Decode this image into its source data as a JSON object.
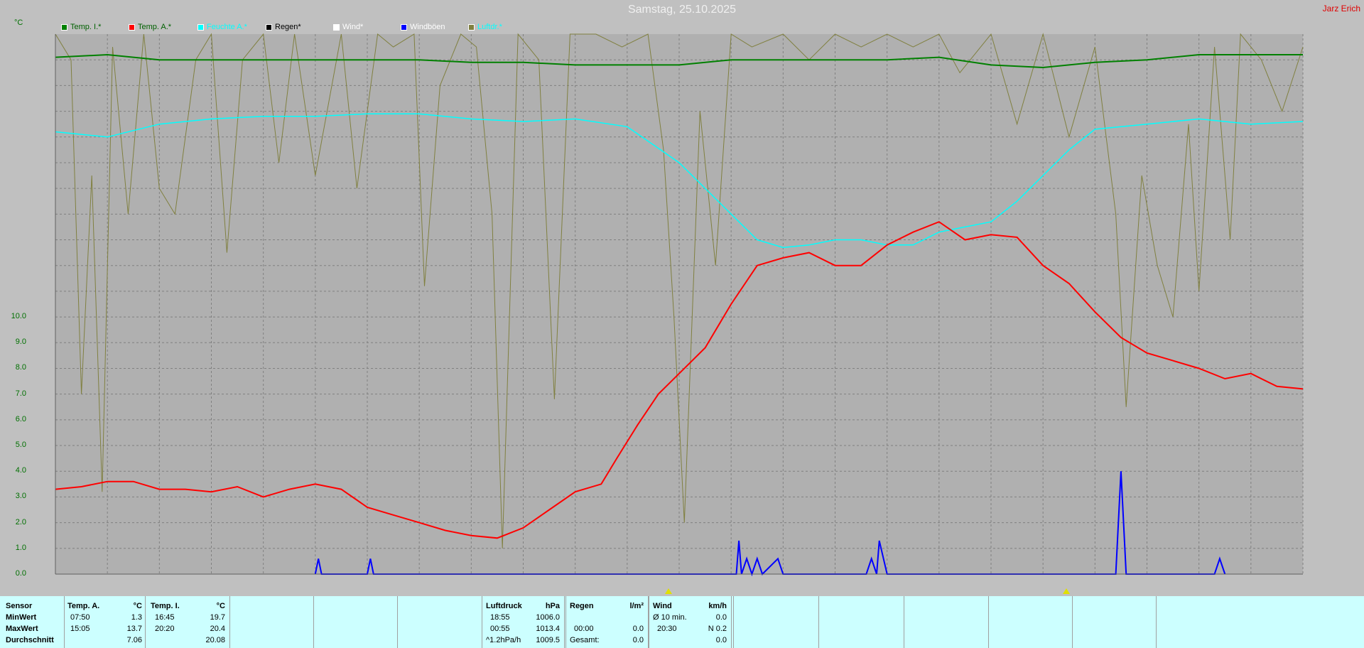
{
  "header": {
    "title": "Samstag, 25.10.2025",
    "station": "Jarz Erich",
    "unit": "°C"
  },
  "legend": [
    {
      "label": "Temp. I.*",
      "color": "#008000",
      "text_color": "#006000"
    },
    {
      "label": "Temp. A.*",
      "color": "#ff0000",
      "text_color": "#006000"
    },
    {
      "label": "Feuchte A.*",
      "color": "#00ffff",
      "text_color": "#00ffff"
    },
    {
      "label": "Regen*",
      "color": "#000000",
      "text_color": "#000000"
    },
    {
      "label": "Wind*",
      "color": "#ffffff",
      "text_color": "#ffffff"
    },
    {
      "label": "Windböen",
      "color": "#0000ff",
      "text_color": "#ffffff"
    },
    {
      "label": "Luftdr.*",
      "color": "#808040",
      "text_color": "#00ffff"
    }
  ],
  "colors": {
    "background": "#c0c0c0",
    "plot": "#b0b0b0",
    "grid": "#808080",
    "axis_text": "#007000"
  },
  "chart_data": {
    "type": "line",
    "title": "Samstag, 25.10.2025",
    "ylabel": "°C",
    "ylim": [
      0,
      21
    ],
    "y_ticks": [
      "0.0",
      "1.0",
      "2.0",
      "3.0",
      "4.0",
      "5.0",
      "6.0",
      "7.0",
      "8.0",
      "9.0",
      "10.0"
    ],
    "x_hours": [
      0,
      24
    ],
    "series": [
      {
        "name": "Temp. A.*",
        "color": "#ff0000",
        "points": [
          [
            0,
            3.3
          ],
          [
            0.5,
            3.4
          ],
          [
            1,
            3.6
          ],
          [
            1.5,
            3.6
          ],
          [
            2,
            3.3
          ],
          [
            2.5,
            3.3
          ],
          [
            3,
            3.2
          ],
          [
            3.5,
            3.4
          ],
          [
            4,
            3.0
          ],
          [
            4.5,
            3.3
          ],
          [
            5,
            3.5
          ],
          [
            5.5,
            3.3
          ],
          [
            6,
            2.6
          ],
          [
            6.5,
            2.3
          ],
          [
            7,
            2.0
          ],
          [
            7.5,
            1.7
          ],
          [
            8,
            1.5
          ],
          [
            8.5,
            1.4
          ],
          [
            9,
            1.8
          ],
          [
            9.5,
            2.5
          ],
          [
            10,
            3.2
          ],
          [
            10.5,
            3.5
          ],
          [
            10.8,
            4.5
          ],
          [
            11.2,
            5.8
          ],
          [
            11.6,
            7.0
          ],
          [
            12,
            7.8
          ],
          [
            12.5,
            8.8
          ],
          [
            13,
            10.5
          ],
          [
            13.5,
            12.0
          ],
          [
            14,
            12.3
          ],
          [
            14.5,
            12.5
          ],
          [
            15,
            12.0
          ],
          [
            15.5,
            12.0
          ],
          [
            16,
            12.8
          ],
          [
            16.5,
            13.3
          ],
          [
            17,
            13.7
          ],
          [
            17.5,
            13.0
          ],
          [
            18,
            13.2
          ],
          [
            18.5,
            13.1
          ],
          [
            19,
            12.0
          ],
          [
            19.5,
            11.3
          ],
          [
            20,
            10.2
          ],
          [
            20.5,
            9.2
          ],
          [
            21,
            8.6
          ],
          [
            21.5,
            8.3
          ],
          [
            22,
            8.0
          ],
          [
            22.5,
            7.6
          ],
          [
            23,
            7.8
          ],
          [
            23.5,
            7.3
          ],
          [
            24,
            7.2
          ]
        ]
      },
      {
        "name": "Temp. I.*",
        "color": "#008000",
        "points": [
          [
            0,
            20.1
          ],
          [
            1,
            20.2
          ],
          [
            2,
            20.0
          ],
          [
            3,
            20.0
          ],
          [
            4,
            20.0
          ],
          [
            5,
            20.0
          ],
          [
            6,
            20.0
          ],
          [
            7,
            20.0
          ],
          [
            8,
            19.9
          ],
          [
            9,
            19.9
          ],
          [
            10,
            19.8
          ],
          [
            11,
            19.8
          ],
          [
            12,
            19.8
          ],
          [
            13,
            20.0
          ],
          [
            14,
            20.0
          ],
          [
            15,
            20.0
          ],
          [
            16,
            20.0
          ],
          [
            17,
            20.1
          ],
          [
            18,
            19.8
          ],
          [
            19,
            19.7
          ],
          [
            20,
            19.9
          ],
          [
            21,
            20.0
          ],
          [
            22,
            20.2
          ],
          [
            23,
            20.2
          ],
          [
            24,
            20.2
          ]
        ]
      },
      {
        "name": "Feuchte A.*",
        "color": "#00ffff",
        "points": [
          [
            0,
            17.2
          ],
          [
            1,
            17.0
          ],
          [
            2,
            17.5
          ],
          [
            3,
            17.7
          ],
          [
            4,
            17.8
          ],
          [
            5,
            17.8
          ],
          [
            6,
            17.9
          ],
          [
            7,
            17.9
          ],
          [
            8,
            17.7
          ],
          [
            9,
            17.6
          ],
          [
            10,
            17.7
          ],
          [
            11,
            17.4
          ],
          [
            12,
            16.0
          ],
          [
            12.5,
            15.0
          ],
          [
            13,
            14.0
          ],
          [
            13.5,
            13.0
          ],
          [
            14,
            12.7
          ],
          [
            14.5,
            12.8
          ],
          [
            15,
            13.0
          ],
          [
            15.5,
            13.0
          ],
          [
            16,
            12.8
          ],
          [
            16.5,
            12.8
          ],
          [
            17,
            13.3
          ],
          [
            17.5,
            13.5
          ],
          [
            18,
            13.7
          ],
          [
            18.5,
            14.5
          ],
          [
            19,
            15.5
          ],
          [
            19.5,
            16.5
          ],
          [
            20,
            17.3
          ],
          [
            21,
            17.5
          ],
          [
            22,
            17.7
          ],
          [
            23,
            17.5
          ],
          [
            24,
            17.6
          ]
        ]
      },
      {
        "name": "Windböen",
        "color": "#0000ff",
        "points": [
          [
            5,
            0
          ],
          [
            5.06,
            0.6
          ],
          [
            5.12,
            0
          ],
          [
            6,
            0
          ],
          [
            6.06,
            0.6
          ],
          [
            6.12,
            0
          ],
          [
            13.1,
            0
          ],
          [
            13.15,
            1.3
          ],
          [
            13.2,
            0
          ],
          [
            13.3,
            0.6
          ],
          [
            13.4,
            0
          ],
          [
            13.5,
            0.6
          ],
          [
            13.6,
            0
          ],
          [
            13.9,
            0.6
          ],
          [
            14,
            0
          ],
          [
            15.6,
            0
          ],
          [
            15.7,
            0.6
          ],
          [
            15.8,
            0
          ],
          [
            15.85,
            1.3
          ],
          [
            16,
            0
          ],
          [
            20.4,
            0
          ],
          [
            20.5,
            4.0
          ],
          [
            20.6,
            0
          ],
          [
            22.3,
            0
          ],
          [
            22.4,
            0.6
          ],
          [
            22.5,
            0
          ]
        ]
      },
      {
        "name": "Luftdr.*",
        "color": "#808040",
        "points": [
          [
            0,
            21
          ],
          [
            0.3,
            20.0
          ],
          [
            0.5,
            7.0
          ],
          [
            0.7,
            15.5
          ],
          [
            0.9,
            3.2
          ],
          [
            1.1,
            20.5
          ],
          [
            1.4,
            14.0
          ],
          [
            1.7,
            21
          ],
          [
            2.0,
            15.0
          ],
          [
            2.3,
            14.0
          ],
          [
            2.7,
            20.0
          ],
          [
            3.0,
            21
          ],
          [
            3.3,
            12.5
          ],
          [
            3.6,
            20.0
          ],
          [
            4.0,
            21
          ],
          [
            4.3,
            16.0
          ],
          [
            4.6,
            21
          ],
          [
            5.0,
            15.5
          ],
          [
            5.5,
            21
          ],
          [
            5.8,
            15.0
          ],
          [
            6.2,
            21
          ],
          [
            6.5,
            20.5
          ],
          [
            6.9,
            21
          ],
          [
            7.1,
            11.2
          ],
          [
            7.4,
            19.0
          ],
          [
            7.8,
            21
          ],
          [
            8.1,
            20.5
          ],
          [
            8.4,
            14.0
          ],
          [
            8.6,
            1.0
          ],
          [
            8.9,
            21
          ],
          [
            9.3,
            20.0
          ],
          [
            9.6,
            6.8
          ],
          [
            9.9,
            21
          ],
          [
            10.4,
            21
          ],
          [
            10.9,
            20.5
          ],
          [
            11.4,
            21
          ],
          [
            11.7,
            16.5
          ],
          [
            11.9,
            10.0
          ],
          [
            12.1,
            2.0
          ],
          [
            12.4,
            18.0
          ],
          [
            12.7,
            12.0
          ],
          [
            13.0,
            21
          ],
          [
            13.4,
            20.5
          ],
          [
            14.0,
            21
          ],
          [
            14.5,
            20.0
          ],
          [
            15.0,
            21
          ],
          [
            15.5,
            20.5
          ],
          [
            16.0,
            21
          ],
          [
            16.5,
            20.5
          ],
          [
            17.0,
            21
          ],
          [
            17.4,
            19.5
          ],
          [
            18.0,
            21
          ],
          [
            18.5,
            17.5
          ],
          [
            19.0,
            21
          ],
          [
            19.5,
            17.0
          ],
          [
            20.0,
            20.5
          ],
          [
            20.4,
            14.0
          ],
          [
            20.6,
            6.5
          ],
          [
            20.9,
            15.5
          ],
          [
            21.2,
            12.0
          ],
          [
            21.5,
            10.0
          ],
          [
            21.8,
            17.5
          ],
          [
            22.0,
            11.0
          ],
          [
            22.3,
            20.5
          ],
          [
            22.6,
            13.0
          ],
          [
            22.8,
            21
          ],
          [
            23.2,
            20.0
          ],
          [
            23.6,
            18.0
          ],
          [
            24,
            20.5
          ]
        ]
      }
    ]
  },
  "markers": [
    {
      "name": "sunrise-marker",
      "hour": 11.8
    },
    {
      "name": "sunset-marker",
      "hour": 19.45
    }
  ],
  "footer": {
    "sensor": {
      "header": "Sensor",
      "rows": [
        "MinWert",
        "MaxWert",
        "Durchschnitt"
      ]
    },
    "temp_a": {
      "header": "Temp. A.",
      "unit": "°C",
      "times": [
        "07:50",
        "15:05",
        ""
      ],
      "values": [
        "1.3",
        "13.7",
        "7.06"
      ]
    },
    "temp_i": {
      "header": "Temp. I.",
      "unit": "°C",
      "times": [
        "16:45",
        "20:20",
        ""
      ],
      "values": [
        "19.7",
        "20.4",
        "20.08"
      ]
    },
    "druck": {
      "header": "Luftdruck",
      "unit": "hPa",
      "times": [
        "18:55",
        "00:55",
        "^1.2hPa/h"
      ],
      "values": [
        "1006.0",
        "1013.4",
        "1009.5"
      ]
    },
    "regen": {
      "header": "Regen",
      "unit": "l/m²",
      "times": [
        "",
        "00:00",
        "Gesamt:"
      ],
      "values": [
        "",
        "0.0",
        "0.0"
      ]
    },
    "wind": {
      "header": "Wind",
      "unit": "km/h",
      "times": [
        "Ø 10 min.",
        "20:30",
        ""
      ],
      "values": [
        "0.0",
        "N 0.2",
        "0.0"
      ]
    }
  }
}
